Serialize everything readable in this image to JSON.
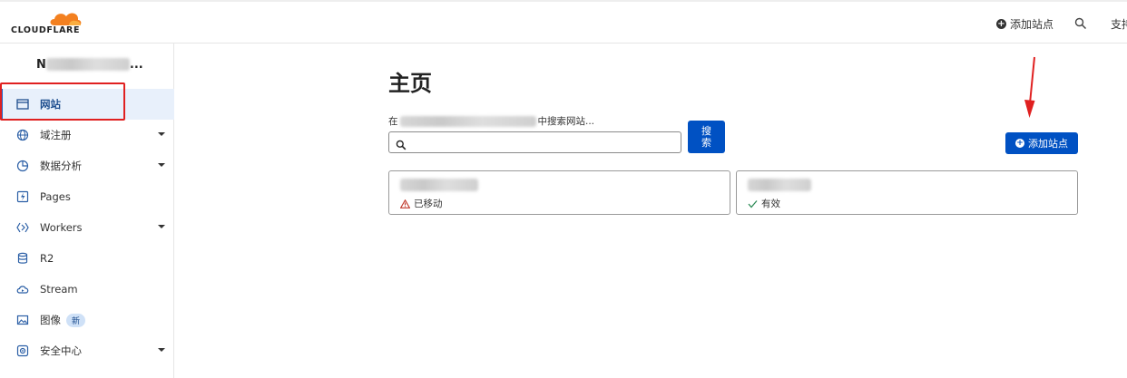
{
  "topbar": {
    "logo_text": "CLOUDFLARE",
    "add_site_label": "添加站点",
    "search_icon": "search-icon",
    "support_label": "支持"
  },
  "sidebar": {
    "account_name_visible": "N",
    "account_suffix": "...",
    "items": [
      {
        "label": "网站",
        "icon": "browser-window-icon",
        "active": true,
        "has_caret": false
      },
      {
        "label": "域注册",
        "icon": "globe-icon",
        "active": false,
        "has_caret": true
      },
      {
        "label": "数据分析",
        "icon": "pie-chart-icon",
        "active": false,
        "has_caret": true
      },
      {
        "label": "Pages",
        "icon": "lightning-icon",
        "active": false,
        "has_caret": false
      },
      {
        "label": "Workers",
        "icon": "workers-diamond-icon",
        "active": false,
        "has_caret": true
      },
      {
        "label": "R2",
        "icon": "database-icon",
        "active": false,
        "has_caret": false
      },
      {
        "label": "Stream",
        "icon": "cloud-play-icon",
        "active": false,
        "has_caret": false
      },
      {
        "label": "图像",
        "icon": "image-icon",
        "active": false,
        "has_caret": false,
        "badge": "新"
      },
      {
        "label": "安全中心",
        "icon": "security-icon",
        "active": false,
        "has_caret": true
      }
    ]
  },
  "main": {
    "title": "主页",
    "search_prefix": "在",
    "search_suffix": "中搜索网站...",
    "search_value": "",
    "search_button": "搜索",
    "add_site_button": "添加站点",
    "sites": [
      {
        "status": "已移动",
        "status_type": "warning"
      },
      {
        "status": "有效",
        "status_type": "active"
      }
    ]
  },
  "colors": {
    "brand_orange": "#f38020",
    "primary_blue": "#0051c3",
    "annotation_red": "#e02020"
  }
}
